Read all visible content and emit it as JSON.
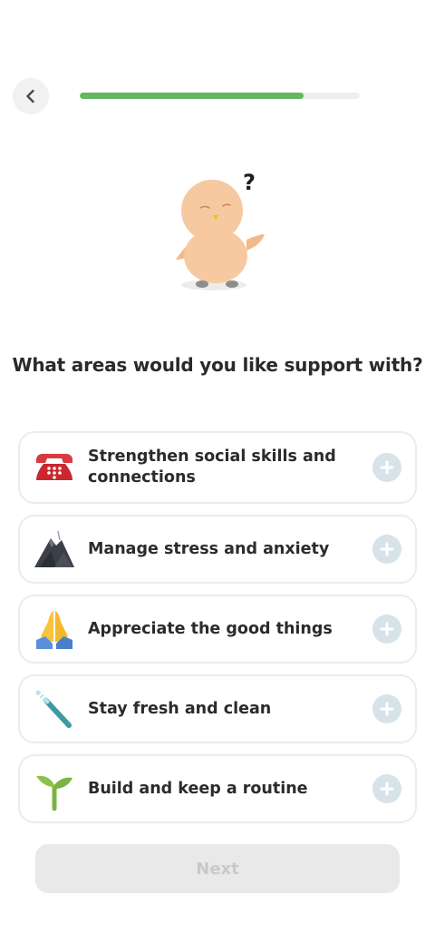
{
  "header": {
    "back_icon": "chevron-left-icon",
    "progress": 0.8,
    "progress_color": "#62b75f"
  },
  "mascot": {
    "question_mark": "?",
    "icon": "bird-mascot-icon"
  },
  "question": "What areas would you like support with?",
  "options": [
    {
      "label": "Strengthen social skills and connections",
      "icon": "telephone-icon"
    },
    {
      "label": "Manage stress and anxiety",
      "icon": "mountain-icon"
    },
    {
      "label": "Appreciate the good things",
      "icon": "folded-hands-icon"
    },
    {
      "label": "Stay fresh and clean",
      "icon": "toothbrush-icon"
    },
    {
      "label": "Build and keep a routine",
      "icon": "seedling-icon"
    }
  ],
  "add_icon": "plus-icon",
  "next_label": "Next"
}
